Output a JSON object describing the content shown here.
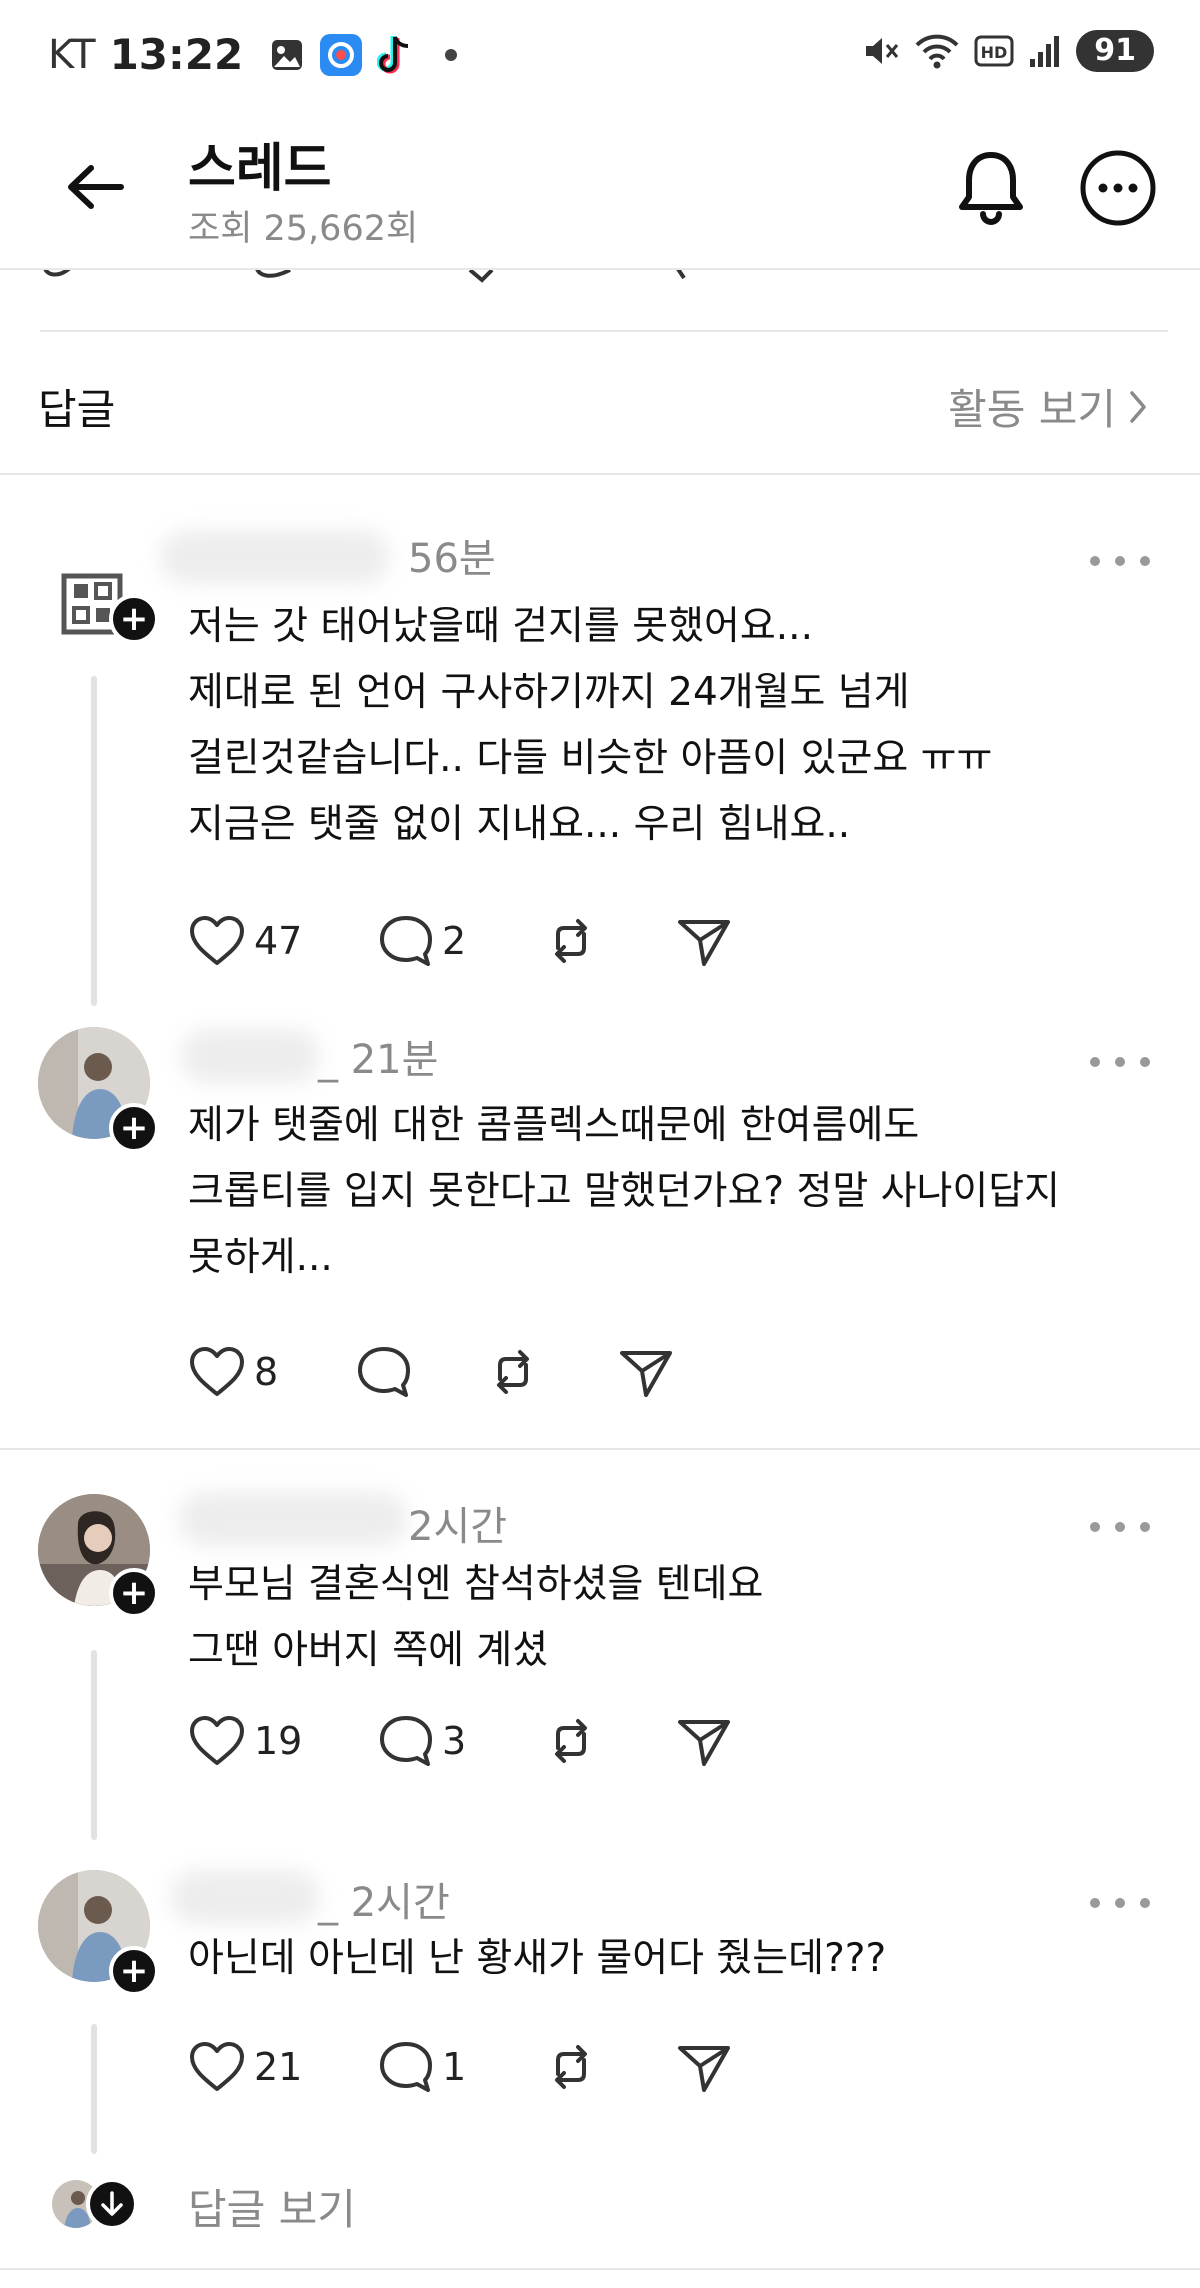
{
  "status_bar": {
    "carrier": "KT",
    "time": "13:22",
    "battery": "91",
    "left_icons": [
      "gallery-icon",
      "app-sync-icon",
      "tiktok-icon",
      "notification-dot"
    ],
    "right_icons": [
      "mute-icon",
      "wifi-icon",
      "hd-icon",
      "signal-icon"
    ]
  },
  "header": {
    "title": "스레드",
    "views": "조회 25,662회"
  },
  "replies_bar": {
    "label": "답글",
    "activity_link": "활동 보기"
  },
  "comments": [
    {
      "time": "56분",
      "lines": [
        "저는 갓 태어났을때 걷지를 못했어요...",
        "제대로 된 언어 구사하기까지 24개월도 넘게",
        "걸린것같습니다.. 다들 비슷한 아픔이 있군요 ㅠㅠ",
        "지금은 탯줄 없이 지내요... 우리 힘내요.."
      ],
      "likes": "47",
      "replies": "2"
    },
    {
      "time": "_ 21분",
      "lines": [
        "제가 탯줄에 대한 콤플렉스때문에 한여름에도",
        "크롭티를 입지 못한다고 말했던가요? 정말 사나이답지",
        "못하게..."
      ],
      "likes": "8",
      "replies": ""
    },
    {
      "time": "2시간",
      "lines": [
        "부모님 결혼식엔 참석하셨을 텐데요",
        "그땐 아버지 쪽에 계셨"
      ],
      "likes": "19",
      "replies": "3"
    },
    {
      "time": "_ 2시간",
      "lines": [
        "아닌데 아닌데 난 황새가 물어다 줬는데???"
      ],
      "likes": "21",
      "replies": "1"
    }
  ],
  "view_replies": "답글 보기",
  "colors": {
    "text": "#111111",
    "secondary": "#8a8a8a",
    "divider": "#e6e6e6",
    "thread_line": "#e2e2e2"
  }
}
